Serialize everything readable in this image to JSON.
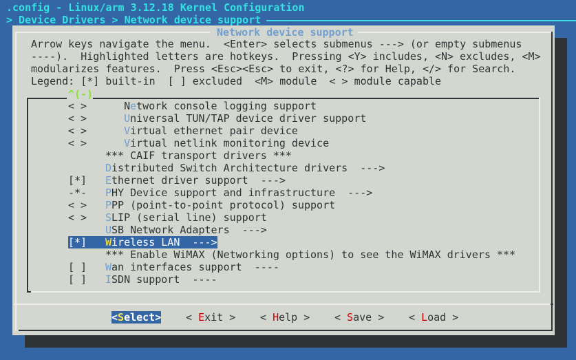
{
  "window": {
    "title": ".config - Linux/arm 3.12.18 Kernel Configuration",
    "breadcrumb": "> Device Drivers > Network device support"
  },
  "dialog": {
    "title": "Network device support",
    "help_lines": [
      "Arrow keys navigate the menu.  <Enter> selects submenus ---> (or empty submenus",
      "----).  Highlighted letters are hotkeys.  Pressing <Y> includes, <N> excludes, <M>",
      "modularizes features.  Press <Esc><Esc> to exit, <?> for Help, </> for Search.",
      "Legend: [*] built-in  [ ] excluded  <M> module  < > module capable"
    ],
    "scroll_indicator": "^(-)"
  },
  "menu": {
    "items": [
      {
        "state": "< >",
        "indent": "   ",
        "hotkey": "N",
        "rest": "etwork console logging support",
        "hotkey_pos": 1,
        "selected": false
      },
      {
        "state": "< >",
        "indent": "   ",
        "hotkey": "U",
        "rest": "niversal TUN/TAP device driver support",
        "hotkey_pos": 0,
        "selected": false
      },
      {
        "state": "< >",
        "indent": "   ",
        "hotkey": "V",
        "rest": "irtual ethernet pair device",
        "hotkey_pos": 0,
        "selected": false
      },
      {
        "state": "< >",
        "indent": "   ",
        "hotkey": "V",
        "rest": "irtual netlink monitoring device",
        "hotkey_pos": 0,
        "selected": false
      },
      {
        "state": "",
        "indent": "",
        "hotkey": "",
        "rest": "*** CAIF transport drivers ***",
        "selected": false
      },
      {
        "state": "",
        "indent": "",
        "hotkey": "D",
        "rest": "istributed Switch Architecture drivers  --->",
        "selected": false
      },
      {
        "state": "[*]",
        "indent": "",
        "hotkey": "E",
        "rest": "thernet driver support  --->",
        "selected": false
      },
      {
        "state": "-*-",
        "indent": "",
        "hotkey": "P",
        "rest": "HY Device support and infrastructure  --->",
        "selected": false
      },
      {
        "state": "< >",
        "indent": "",
        "hotkey": "P",
        "rest": "PP (point-to-point protocol) support",
        "selected": false
      },
      {
        "state": "< >",
        "indent": "",
        "hotkey": "S",
        "rest": "LIP (serial line) support",
        "selected": false
      },
      {
        "state": "",
        "indent": "",
        "hotkey": "U",
        "rest": "SB Network Adapters  --->",
        "selected": false
      },
      {
        "state": "[*]",
        "indent": "",
        "hotkey": "W",
        "rest": "ireless LAN  --->",
        "selected": true
      },
      {
        "state": "",
        "indent": "",
        "hotkey": "",
        "rest": "*** Enable WiMAX (Networking options) to see the WiMAX drivers ***",
        "selected": false
      },
      {
        "state": "[ ]",
        "indent": "",
        "hotkey": "W",
        "rest": "an interfaces support  ----",
        "selected": false
      },
      {
        "state": "[ ]",
        "indent": "",
        "hotkey": "I",
        "rest": "SDN support  ----",
        "selected": false
      }
    ]
  },
  "buttons": [
    {
      "pre": "<",
      "hotkey": "S",
      "post": "elect>",
      "active": true
    },
    {
      "pre": "< ",
      "hotkey": "E",
      "post": "xit >",
      "active": false
    },
    {
      "pre": "< ",
      "hotkey": "H",
      "post": "elp >",
      "active": false
    },
    {
      "pre": "< ",
      "hotkey": "S",
      "post": "ave >",
      "active": false
    },
    {
      "pre": "< ",
      "hotkey": "L",
      "post": "oad >",
      "active": false
    }
  ],
  "colors": {
    "background": "#3465a4",
    "dialog": "#d3d7cf",
    "title_text": "#34e2e2",
    "dialog_title": "#729fcf",
    "hotkey": "#729fcf",
    "selected_bg": "#3465a4",
    "selected_hotkey": "#fce94f",
    "button_hotkey": "#cc0000",
    "scroll_indicator": "#8ae234"
  }
}
